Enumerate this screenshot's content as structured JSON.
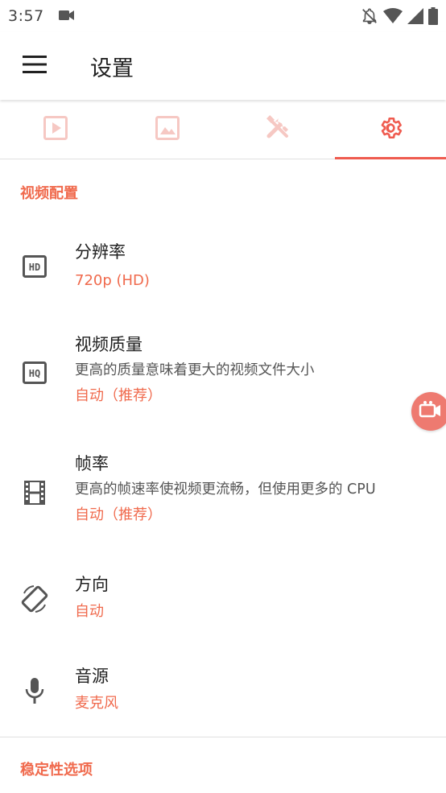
{
  "status_bar": {
    "time": "3:57",
    "icons": [
      "video-camera-icon",
      "notifications-off-icon",
      "wifi-icon",
      "signal-icon",
      "battery-icon"
    ]
  },
  "app_bar": {
    "menu_icon": "hamburger-menu-icon",
    "title": "设置"
  },
  "tabs": [
    {
      "icon": "play-video-icon",
      "active": false
    },
    {
      "icon": "image-icon",
      "active": false
    },
    {
      "icon": "tools-icon",
      "active": false
    },
    {
      "icon": "gear-icon",
      "active": true
    }
  ],
  "sections": [
    {
      "header": "视频配置",
      "items": [
        {
          "icon": "hd-icon",
          "title": "分辨率",
          "value": "720p (HD)"
        },
        {
          "icon": "hq-icon",
          "title": "视频质量",
          "description": "更高的质量意味着更大的视频文件大小",
          "value": "自动（推荐）"
        },
        {
          "icon": "film-icon",
          "title": "帧率",
          "description": "更高的帧速率使视频更流畅，但使用更多的 CPU",
          "value": "自动（推荐）"
        },
        {
          "icon": "screen-rotation-icon",
          "title": "方向",
          "value": "自动"
        },
        {
          "icon": "microphone-icon",
          "title": "音源",
          "value": "麦克风"
        }
      ]
    },
    {
      "header": "稳定性选项"
    }
  ],
  "floating_button": {
    "icon": "screen-record-icon"
  },
  "colors": {
    "accent": "#f06a4d",
    "tab_indicator": "#ef5b4f",
    "inactive_tab_icon": "#f6c8c3",
    "icon_gray": "#555555"
  }
}
